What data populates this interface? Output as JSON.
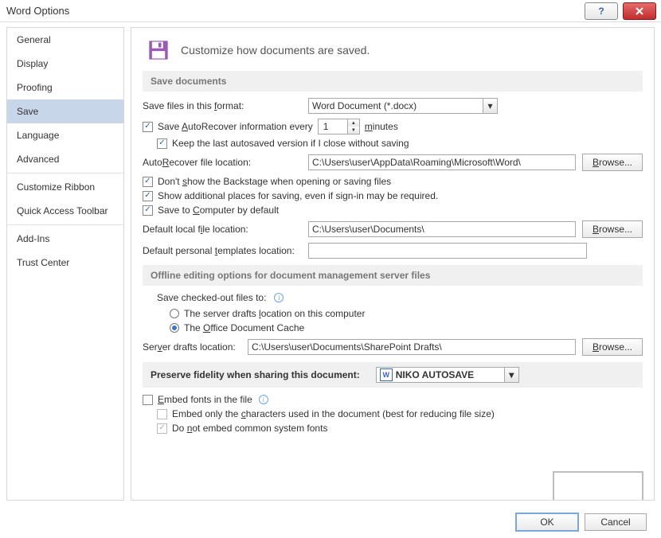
{
  "window": {
    "title": "Word Options"
  },
  "sidebar": {
    "groups": [
      [
        "General",
        "Display",
        "Proofing",
        "Save",
        "Language",
        "Advanced"
      ],
      [
        "Customize Ribbon",
        "Quick Access Toolbar"
      ],
      [
        "Add-Ins",
        "Trust Center"
      ]
    ],
    "selected": "Save"
  },
  "hero": {
    "text": "Customize how documents are saved."
  },
  "save": {
    "header": "Save documents",
    "format_label_pre": "Save files in this ",
    "format_label_u": "f",
    "format_label_post": "ormat:",
    "format_value": "Word Document (*.docx)",
    "autorec_label_pre": "Save ",
    "autorec_label_u": "A",
    "autorec_label_post": "utoRecover information every",
    "autorec_value": "1",
    "autorec_min_u": "m",
    "autorec_min_post": "inutes",
    "keep_last": "Keep the last autosaved version if I close without saving",
    "ar_loc_label_pre": "Auto",
    "ar_loc_label_u": "R",
    "ar_loc_label_post": "ecover file location:",
    "ar_loc_value": "C:\\Users\\user\\AppData\\Roaming\\Microsoft\\Word\\",
    "browse": "Browse...",
    "dont_show_pre": "Don't ",
    "dont_show_u": "s",
    "dont_show_post": "how the Backstage when opening or saving files",
    "show_add": "Show additional places for saving, even if sign-in may be required.",
    "save_comp_pre": "Save to ",
    "save_comp_u": "C",
    "save_comp_post": "omputer by default",
    "def_local_pre": "Default local f",
    "def_local_u": "i",
    "def_local_post": "le location:",
    "def_local_value": "C:\\Users\\user\\Documents\\",
    "def_tmpl_pre": "Default personal ",
    "def_tmpl_u": "t",
    "def_tmpl_post": "emplates location:",
    "def_tmpl_value": ""
  },
  "offline": {
    "header": "Offline editing options for document management server files",
    "save_checked": "Save checked-out files to:",
    "opt1_pre": "The server drafts ",
    "opt1_u": "l",
    "opt1_post": "ocation on this computer",
    "opt2_pre": "The ",
    "opt2_u": "O",
    "opt2_post": "ffice Document Cache",
    "srv_label_pre": "Ser",
    "srv_label_u": "v",
    "srv_label_post": "er drafts location:",
    "srv_value": "C:\\Users\\user\\Documents\\SharePoint Drafts\\"
  },
  "preserve": {
    "header": "Preserve fidelity when sharing this document:",
    "doc_value": "NIKO AUTOSAVE",
    "embed_pre": "",
    "embed_u": "E",
    "embed_post": "mbed fonts in the file",
    "embed_chars_pre": "Embed only the ",
    "embed_chars_u": "c",
    "embed_chars_post": "haracters used in the document (best for reducing file size)",
    "embed_common_pre": "Do ",
    "embed_common_u": "n",
    "embed_common_post": "ot embed common system fonts"
  },
  "footer": {
    "ok": "OK",
    "cancel": "Cancel"
  }
}
